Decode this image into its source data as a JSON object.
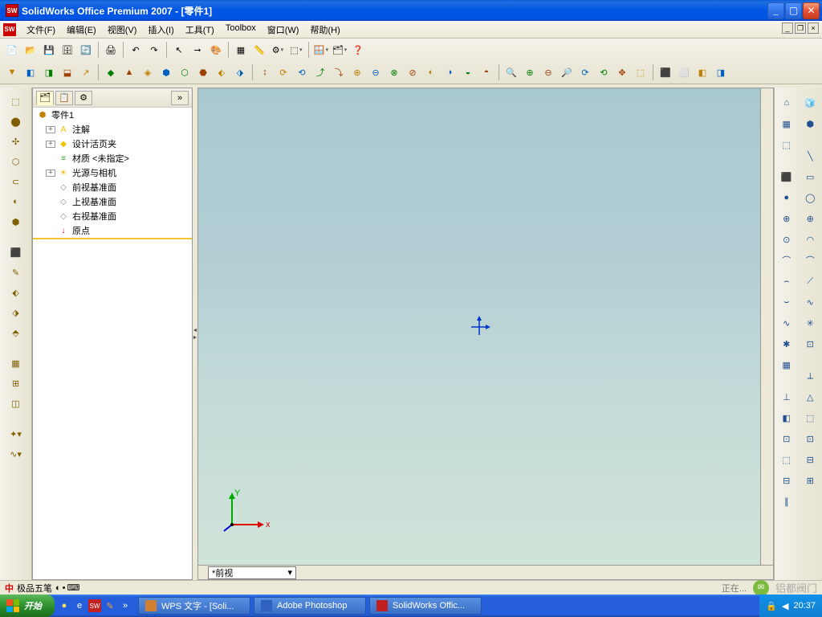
{
  "window": {
    "title": "SolidWorks Office Premium 2007 - [零件1]",
    "app_icon_text": "SW"
  },
  "menu": {
    "items": [
      "文件(F)",
      "编辑(E)",
      "视图(V)",
      "插入(I)",
      "工具(T)",
      "Toolbox",
      "窗口(W)",
      "帮助(H)"
    ]
  },
  "feature_tree": {
    "root": "零件1",
    "items": [
      {
        "label": "注解",
        "icon": "A",
        "icon_color": "#f0c000",
        "expandable": true
      },
      {
        "label": "设计活页夹",
        "icon": "◆",
        "icon_color": "#f0c000",
        "expandable": true
      },
      {
        "label": "材质 <未指定>",
        "icon": "≡",
        "icon_color": "#30a030",
        "expandable": false
      },
      {
        "label": "光源与相机",
        "icon": "☀",
        "icon_color": "#f0c000",
        "expandable": true
      },
      {
        "label": "前视基准面",
        "icon": "◇",
        "icon_color": "#888",
        "expandable": false
      },
      {
        "label": "上视基准面",
        "icon": "◇",
        "icon_color": "#888",
        "expandable": false
      },
      {
        "label": "右视基准面",
        "icon": "◇",
        "icon_color": "#888",
        "expandable": false
      },
      {
        "label": "原点",
        "icon": "↓",
        "icon_color": "#c00",
        "expandable": false
      }
    ]
  },
  "viewport": {
    "axes": {
      "x": "x",
      "y": "Y"
    },
    "view_selector": "*前视"
  },
  "status": {
    "ime_label": "极品五笔",
    "right_text": "正在...",
    "watermark": "铝都阀门"
  },
  "taskbar": {
    "start": "开始",
    "tasks": [
      {
        "label": "WPS 文字 - [Soli...",
        "icon_color": "#d08030"
      },
      {
        "label": "Adobe Photoshop",
        "icon_color": "#3060c0"
      },
      {
        "label": "SolidWorks Offic...",
        "icon_color": "#c02020"
      }
    ],
    "time": "20:37"
  },
  "toolbar_icons": {
    "row1": [
      "new-icon",
      "open-icon",
      "save-icon",
      "saveall-icon",
      "rebuild-icon",
      "print-icon",
      "undo-icon",
      "redo-icon",
      "select-icon",
      "select-filter-icon",
      "color-icon",
      "grid-icon",
      "measure-icon",
      "options-icon",
      "box-icon",
      "window-icon",
      "cascade-icon",
      "help-icon"
    ],
    "row2_count": 42,
    "left_count": 19,
    "right_col1_count": 18,
    "right_col2_count": 18
  }
}
